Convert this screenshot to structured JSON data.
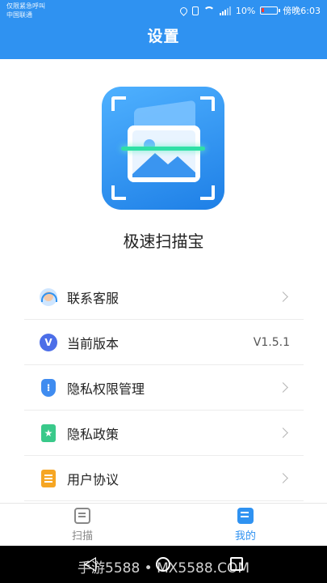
{
  "status_bar": {
    "carrier_line1": "仅限紧急呼叫",
    "carrier_line2": "中国联通",
    "battery": "10%",
    "time": "傍晚6:03",
    "icons": [
      "location-icon",
      "vibrate-icon",
      "wifi-icon",
      "signal-icon",
      "battery-icon"
    ],
    "battery_color": "#ff3b30"
  },
  "header": {
    "title": "设置",
    "background": "#2f92f1"
  },
  "app": {
    "name": "极速扫描宝",
    "logo_icon": "scan-image-logo"
  },
  "menu": {
    "items": [
      {
        "label": "联系客服",
        "icon": "customer-service-icon",
        "value": "",
        "chevron": true
      },
      {
        "label": "当前版本",
        "icon": "version-v-icon",
        "value": "V1.5.1",
        "chevron": false
      },
      {
        "label": "隐私权限管理",
        "icon": "shield-icon",
        "value": "",
        "chevron": true
      },
      {
        "label": "隐私政策",
        "icon": "bookmark-star-icon",
        "value": "",
        "chevron": true
      },
      {
        "label": "用户协议",
        "icon": "document-icon",
        "value": "",
        "chevron": true
      }
    ]
  },
  "tabs": [
    {
      "label": "扫描",
      "icon": "scan-tab-icon",
      "active": false
    },
    {
      "label": "我的",
      "icon": "mine-tab-icon",
      "active": true
    }
  ],
  "accent_color": "#2f92f1",
  "navbar": {
    "watermark": "手游5588 • MX5588.COM"
  }
}
